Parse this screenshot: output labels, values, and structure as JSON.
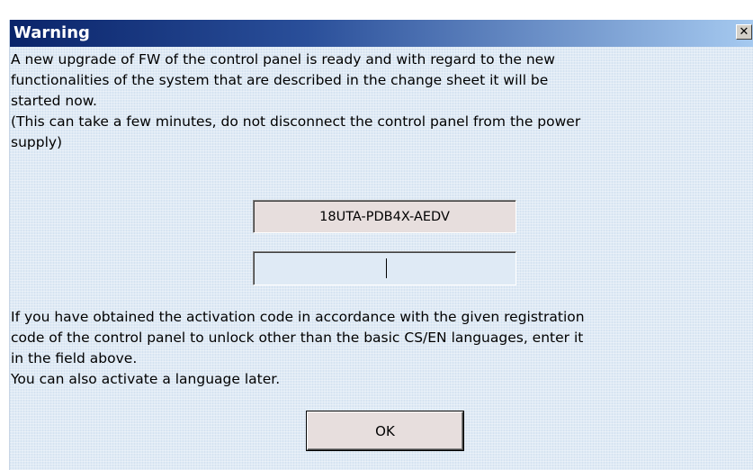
{
  "window": {
    "title": "Warning",
    "close_glyph": "✕"
  },
  "message": {
    "top": "A new upgrade of FW of the control panel is ready and with regard to the new\nfunctionalities of the system that are described in the change sheet it will be\nstarted now.\n(This can take a few minutes, do not disconnect the control panel from the power\nsupply)",
    "bottom": "If you have obtained the activation code in accordance with the given registration\ncode of the control panel to unlock other than the basic CS/EN languages, enter it\nin the field above.\n You can also activate a language later."
  },
  "registration_code": {
    "value": "18UTA-PDB4X-AEDV"
  },
  "activation_code": {
    "value": "",
    "placeholder": ""
  },
  "buttons": {
    "ok_label": "OK"
  },
  "colors": {
    "title_gradient_start": "#0a246a",
    "title_gradient_end": "#a6caf0",
    "dialog_background": "#dfeaf5",
    "button_face": "#e7dedd"
  }
}
